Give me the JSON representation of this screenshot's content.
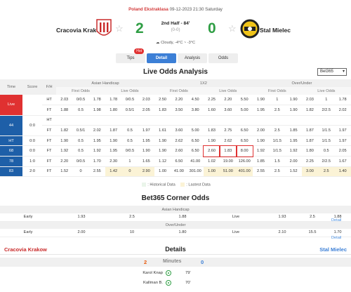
{
  "header": {
    "league": "Poland Ekstraklasa",
    "datetime": "09-12-2023 21:30 Saturday",
    "home_team": "Cracovia Krakow",
    "away_team": "Stal Mielec",
    "home_score": "2",
    "away_score": "0",
    "status": "2nd Half - 84'",
    "half_score": "(0-0)",
    "weather": "Cloudy, -4°C ~ -3°C"
  },
  "tabs": [
    {
      "label": "Tips",
      "badge": "Hot"
    },
    {
      "label": "Detail"
    },
    {
      "label": "Analysis"
    },
    {
      "label": "Odds"
    }
  ],
  "live_odds": {
    "title": "Live Odds Analysis",
    "bookmaker": "Bet365",
    "group_headers": [
      "Asian Handicap",
      "1X2",
      "Over/Under"
    ],
    "col_headers": [
      "Time",
      "Score",
      "F/H"
    ],
    "sub_headers": [
      "First Odds",
      "Live Odds",
      "First Odds",
      "Live Odds",
      "First Odds",
      "Live Odds"
    ],
    "rows": [
      {
        "time": "Live",
        "score": "",
        "fh": "HT",
        "v": [
          "2.03",
          "0/0.5",
          "1.78",
          "1.78",
          "0/0.5",
          "2.03",
          "2.50",
          "2.20",
          "4.50",
          "2.25",
          "2.20",
          "5.50",
          "1.90",
          "1",
          "1.90",
          "2.03",
          "1",
          "1.78"
        ]
      },
      {
        "time": "",
        "score": "",
        "fh": "FT",
        "v": [
          "1.88",
          "0.5",
          "1.98",
          "1.80",
          "0.5/1",
          "2.05",
          "1.83",
          "3.50",
          "3.80",
          "1.60",
          "3.60",
          "5.00",
          "1.95",
          "2.5",
          "1.90",
          "1.82",
          "2/2.5",
          "2.02"
        ]
      },
      {
        "time": "44",
        "score": "0:0",
        "fh": "HT",
        "v": [
          "",
          "",
          "",
          "",
          "",
          "",
          "",
          "",
          "",
          "",
          "",
          "",
          "",
          "",
          "",
          "",
          "",
          ""
        ]
      },
      {
        "time": "",
        "score": "",
        "fh": "FT",
        "v": [
          "1.82",
          "0.5/1",
          "2.02",
          "1.87",
          "0.5",
          "1.97",
          "1.61",
          "3.60",
          "5.00",
          "1.83",
          "2.75",
          "6.50",
          "2.00",
          "2.5",
          "1.85",
          "1.87",
          "1/1.5",
          "1.97"
        ]
      },
      {
        "time": "HT",
        "score": "0:0",
        "fh": "FT",
        "v": [
          "1.90",
          "0.5",
          "1.95",
          "1.90",
          "0.5",
          "1.95",
          "1.90",
          "2.62",
          "6.50",
          "1.90",
          "2.62",
          "6.50",
          "1.90",
          "1/1.5",
          "1.95",
          "1.87",
          "1/1.5",
          "1.97"
        ]
      },
      {
        "time": "68",
        "score": "0:0",
        "fh": "FT",
        "v": [
          "1.92",
          "0.5",
          "1.92",
          "1.95",
          "0/0.5",
          "1.90",
          "1.90",
          "2.60",
          "6.50",
          "2.60",
          "1.83",
          "8.00",
          "1.92",
          "1/1.5",
          "1.92",
          "1.80",
          "0.5",
          "2.05"
        ]
      },
      {
        "time": "78",
        "score": "1:0",
        "fh": "FT",
        "v": [
          "2.20",
          "0/0.5",
          "1.70",
          "2.30",
          "1",
          "1.65",
          "1.12",
          "6.50",
          "41.00",
          "1.02",
          "19.00",
          "126.00",
          "1.85",
          "1.5",
          "2.00",
          "2.25",
          "2/2.5",
          "1.67"
        ]
      },
      {
        "time": "83",
        "score": "2:0",
        "fh": "FT",
        "v": [
          "1.52",
          "0",
          "2.55",
          "1.42",
          "0",
          "2.90",
          "1.00",
          "41.00",
          "301.00",
          "1.00",
          "51.00",
          "401.00",
          "2.55",
          "2.5",
          "1.52",
          "3.00",
          "2.5",
          "1.40"
        ]
      }
    ],
    "legend_historical": ": Historical Data",
    "legend_lastest": ": Lastest Data"
  },
  "corner": {
    "title": "Bet365 Corner Odds",
    "sections": [
      {
        "header": "Asian Handicap",
        "early_label": "Early",
        "early": [
          "1.93",
          "2.5",
          "1.88"
        ],
        "live_label": "Live",
        "live": [
          "1.93",
          "2.5",
          "1.88"
        ],
        "detail": "Detail"
      },
      {
        "header": "Over/Under",
        "early_label": "Early",
        "early": [
          "2.00",
          "10",
          "1.80"
        ],
        "live_label": "Live",
        "live": [
          "2.10",
          "15.5",
          "1.70"
        ],
        "detail": "Detail"
      }
    ]
  },
  "details": {
    "title": "Details",
    "home": "Cracovia Krakow",
    "away": "Stal Mielec",
    "minutes_label": "Minutes",
    "home_score": "2",
    "away_score": "0",
    "events": [
      {
        "player": "Karol Knap",
        "minute": "79'"
      },
      {
        "player": "Kallman B.",
        "minute": "70'"
      }
    ]
  },
  "colors": {
    "accent": "#3c7fd6",
    "live": "#e03131",
    "time_cell": "#1e5fa8",
    "score": "#2f9e44"
  }
}
